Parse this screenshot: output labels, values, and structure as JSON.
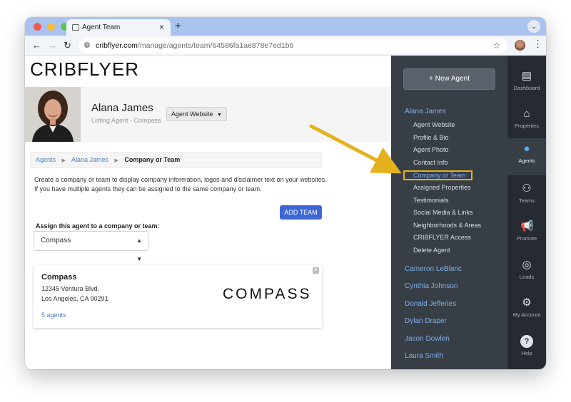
{
  "browser": {
    "tab_title": "Agent Team",
    "url_host": "cribflyer.com",
    "url_path": "/manage/agents/team/64586fa1ae878e7ed1b6"
  },
  "site": {
    "logo": "CRIBFLYER"
  },
  "profile": {
    "name": "Alana James",
    "subtitle": "Listing Agent · Compass",
    "website_button": "Agent Website"
  },
  "breadcrumb": {
    "agents": "Agents",
    "agent": "Alana James",
    "current": "Company or Team"
  },
  "description": {
    "line1": "Create a company or team to display company information, logos and disclaimer text on your websites.",
    "line2": "If you have multiple agents they can be assigned to the same company or team."
  },
  "add_team_label": "ADD TEAM",
  "assign": {
    "label": "Assign this agent to a company or team:",
    "selected": "Compass"
  },
  "company": {
    "name": "Compass",
    "address1": "12345 Ventura Blvd.",
    "address2": "Los Angeles, CA 90291",
    "agents_link": "5 agents",
    "logo_text": "COMPASS"
  },
  "panel": {
    "new_agent": "New Agent",
    "current_agent": "Alana James",
    "menu": [
      "Agent Website",
      "Profile & Bio",
      "Agent Photo",
      "Contact Info",
      "Company or Team",
      "Assigned Properties",
      "Testimonials",
      "Social Media & Links",
      "Neighborhoods & Areas",
      "CRIBFLYER Access",
      "Delete Agent"
    ],
    "agents": [
      "Cameron LeBlanc",
      "Cynthia Johnson",
      "Donald Jefferies",
      "Dylan Draper",
      "Jason Dowlen",
      "Laura Smith"
    ]
  },
  "rail": [
    "Dashboard",
    "Properties",
    "Agents",
    "Teams",
    "Promote",
    "Leads",
    "My Account",
    "Help"
  ],
  "colors": {
    "accent": "#3e67d5",
    "highlight": "#e4b21c",
    "panel": "#373e46"
  }
}
